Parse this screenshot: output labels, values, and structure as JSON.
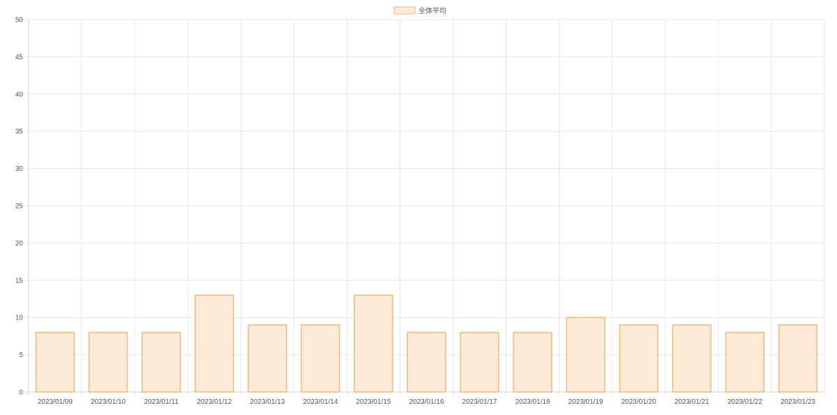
{
  "colors": {
    "bar_fill": "#fdebd7",
    "bar_stroke": "#f2b877",
    "grid": "#e6e6e6",
    "axis": "#d0d0d0",
    "text": "#555555"
  },
  "chart_data": {
    "type": "bar",
    "categories": [
      "2023/01/09",
      "2023/01/10",
      "2023/01/11",
      "2023/01/12",
      "2023/01/13",
      "2023/01/14",
      "2023/01/15",
      "2023/01/16",
      "2023/01/17",
      "2023/01/18",
      "2023/01/19",
      "2023/01/20",
      "2023/01/21",
      "2023/01/22",
      "2023/01/23"
    ],
    "series": [
      {
        "name": "全体平均",
        "values": [
          8,
          8,
          8,
          13,
          9,
          9,
          13,
          8,
          8,
          8,
          10,
          9,
          9,
          8,
          9
        ]
      }
    ],
    "title": "",
    "xlabel": "",
    "ylabel": "",
    "ylim": [
      0,
      50
    ],
    "yticks": [
      0,
      5,
      10,
      15,
      20,
      25,
      30,
      35,
      40,
      45,
      50
    ],
    "grid": true,
    "legend_position": "top-center"
  }
}
